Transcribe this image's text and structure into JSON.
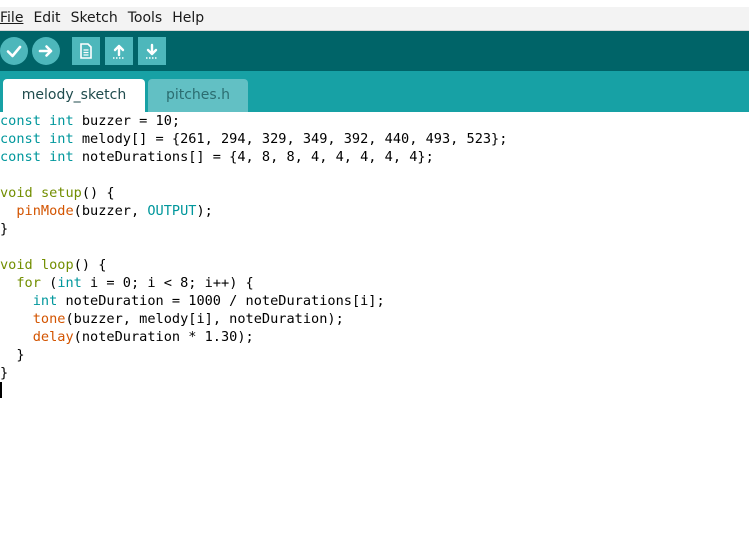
{
  "menu": [
    "File",
    "Edit",
    "Sketch",
    "Tools",
    "Help"
  ],
  "toolbar": {
    "buttons": [
      {
        "name": "verify-button",
        "icon": "checkmark-icon"
      },
      {
        "name": "upload-button",
        "icon": "arrow-right-icon"
      },
      {
        "name": "new-button",
        "icon": "new-file-icon"
      },
      {
        "name": "open-button",
        "icon": "arrow-up-icon"
      },
      {
        "name": "save-button",
        "icon": "arrow-down-icon"
      }
    ]
  },
  "tabs": [
    {
      "label": "melody_sketch",
      "active": true
    },
    {
      "label": "pitches.h",
      "active": false
    }
  ],
  "code": [
    [
      {
        "t": "const",
        "c": "type"
      },
      {
        "t": " "
      },
      {
        "t": "int",
        "c": "type"
      },
      {
        "t": " buzzer = 10;"
      }
    ],
    [
      {
        "t": "const",
        "c": "type"
      },
      {
        "t": " "
      },
      {
        "t": "int",
        "c": "type"
      },
      {
        "t": " melody[] = {261, 294, 329, 349, 392, 440, 493, 523};"
      }
    ],
    [
      {
        "t": "const",
        "c": "type"
      },
      {
        "t": " "
      },
      {
        "t": "int",
        "c": "type"
      },
      {
        "t": " noteDurations[] = {4, 8, 8, 4, 4, 4, 4, 4};"
      }
    ],
    [],
    [
      {
        "t": "void",
        "c": "ctrl"
      },
      {
        "t": " "
      },
      {
        "t": "setup",
        "c": "ctrl"
      },
      {
        "t": "() {"
      }
    ],
    [
      {
        "t": "  "
      },
      {
        "t": "pinMode",
        "c": "func"
      },
      {
        "t": "(buzzer, "
      },
      {
        "t": "OUTPUT",
        "c": "const"
      },
      {
        "t": ");"
      }
    ],
    [
      {
        "t": "}"
      }
    ],
    [],
    [
      {
        "t": "void",
        "c": "ctrl"
      },
      {
        "t": " "
      },
      {
        "t": "loop",
        "c": "ctrl"
      },
      {
        "t": "() {"
      }
    ],
    [
      {
        "t": "  "
      },
      {
        "t": "for",
        "c": "ctrl"
      },
      {
        "t": " ("
      },
      {
        "t": "int",
        "c": "type"
      },
      {
        "t": " i = 0; i < 8; i++) {"
      }
    ],
    [
      {
        "t": "    "
      },
      {
        "t": "int",
        "c": "type"
      },
      {
        "t": " noteDuration = 1000 / noteDurations[i];"
      }
    ],
    [
      {
        "t": "    "
      },
      {
        "t": "tone",
        "c": "func"
      },
      {
        "t": "(buzzer, melody[i], noteDuration);"
      }
    ],
    [
      {
        "t": "    "
      },
      {
        "t": "delay",
        "c": "func"
      },
      {
        "t": "(noteDuration * 1.30);"
      }
    ],
    [
      {
        "t": "  }"
      }
    ],
    [
      {
        "t": "}"
      }
    ]
  ],
  "colors": {
    "toolbar": "#006468",
    "tabbar": "#17a1a5",
    "button": "#4db7bb",
    "keyword_type": "#00979c",
    "keyword_control": "#728e00",
    "function": "#d35400"
  }
}
